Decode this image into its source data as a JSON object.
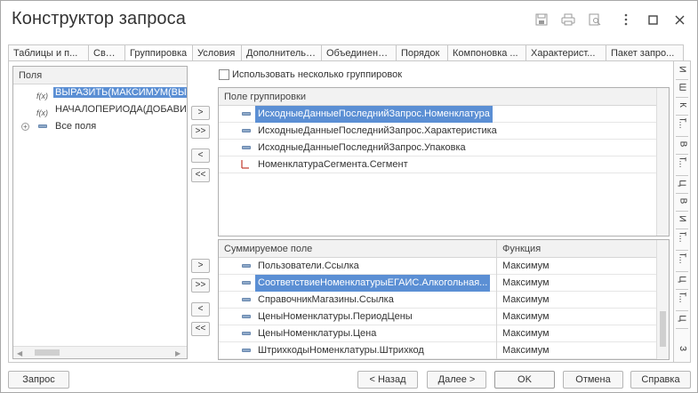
{
  "window": {
    "title": "Конструктор запроса"
  },
  "tabs": [
    "Таблицы и п...",
    "Связи",
    "Группировка",
    "Условия",
    "Дополнительно",
    "Объединени...",
    "Порядок",
    "Компоновка ...",
    "Характерист...",
    "Пакет запро..."
  ],
  "side_tabs": [
    "И",
    "Ш",
    "К",
    "Т...",
    "В",
    "Т...",
    "Ц",
    "В",
    "И",
    "Т...",
    "Т...",
    "Ц",
    "Т...",
    "Ц",
    "З"
  ],
  "fields_panel": {
    "header": "Поля",
    "items": [
      {
        "icon": "f(x)",
        "label": "ВЫРАЗИТЬ(МАКСИМУМ(ВЫ"
      },
      {
        "icon": "f(x)",
        "label": "НАЧАЛОПЕРИОДА(ДОБАВИ"
      },
      {
        "label": "Все поля"
      }
    ]
  },
  "group_checkbox": {
    "label": "Использовать несколько группировок"
  },
  "group_table": {
    "header": "Поле группировки",
    "rows": [
      "ИсходныеДанныеПоследнийЗапрос.Номенклатура",
      "ИсходныеДанныеПоследнийЗапрос.Характеристика",
      "ИсходныеДанныеПоследнийЗапрос.Упаковка",
      "НоменклатураСегмента.Сегмент"
    ]
  },
  "sum_table": {
    "header_field": "Суммируемое поле",
    "header_func": "Функция",
    "rows": [
      {
        "field": "Пользователи.Ссылка",
        "func": "Максимум"
      },
      {
        "field": "СоответствиеНоменклатурыЕГАИС.Алкогольная...",
        "func": "Максимум"
      },
      {
        "field": "СправочникМагазины.Ссылка",
        "func": "Максимум"
      },
      {
        "field": "ЦеныНоменклатуры.ПериодЦены",
        "func": "Максимум"
      },
      {
        "field": "ЦеныНоменклатуры.Цена",
        "func": "Максимум"
      },
      {
        "field": "ШтрихкодыНоменклатуры.Штрихкод",
        "func": "Максимум"
      }
    ]
  },
  "move_buttons": {
    "one": ">",
    "all": ">>",
    "back": "<",
    "back_all": "<<"
  },
  "bottom": {
    "query": "Запрос",
    "back": "< Назад",
    "next": "Далее >",
    "ok": "OK",
    "cancel": "Отмена",
    "help": "Справка"
  },
  "colors": {
    "selection": "#5b8fd4"
  }
}
